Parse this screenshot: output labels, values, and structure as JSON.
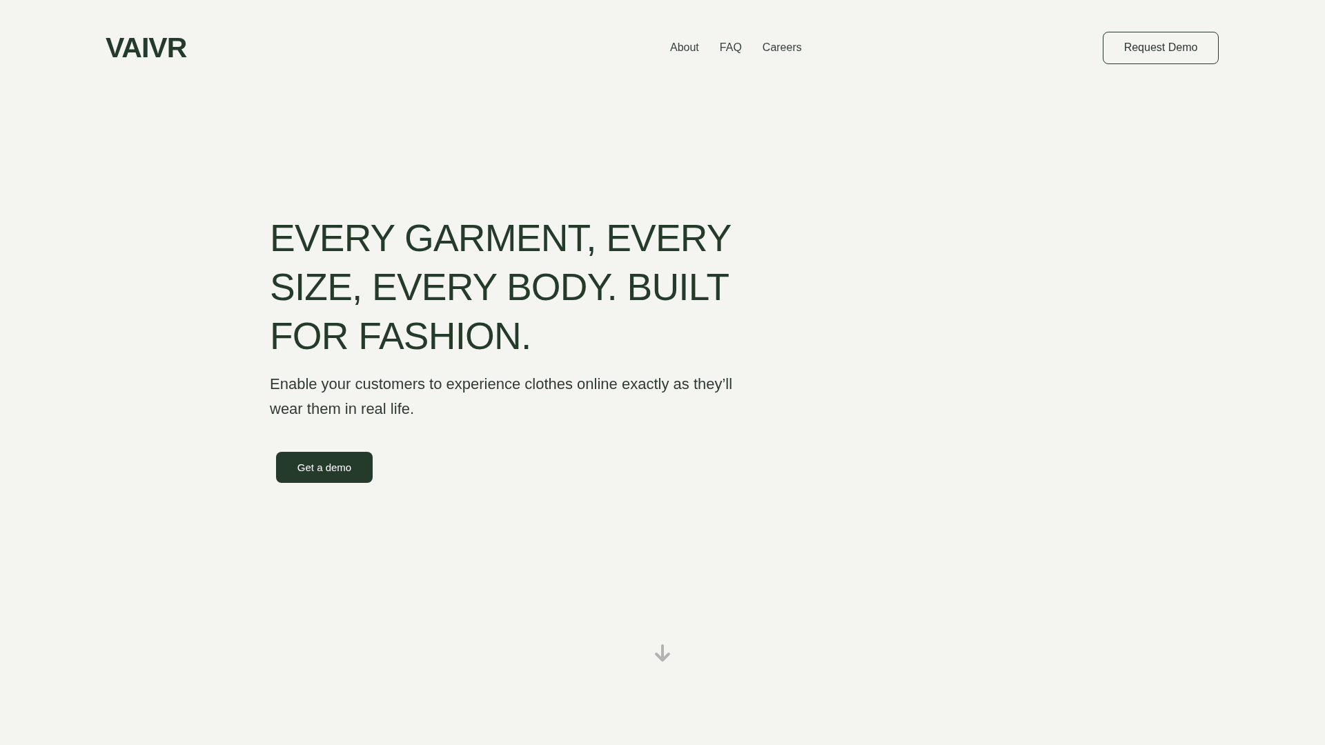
{
  "header": {
    "logo": "VAIVR",
    "nav": [
      "About",
      "FAQ",
      "Careers"
    ],
    "cta": "Request Demo"
  },
  "hero": {
    "title": "EVERY GARMENT, EVERY SIZE, EVERY BODY. BUILT FOR FASHION.",
    "subtitle": "Enable your customers to experience clothes online exactly as they’ll wear them in real life.",
    "button": "Get a demo"
  }
}
